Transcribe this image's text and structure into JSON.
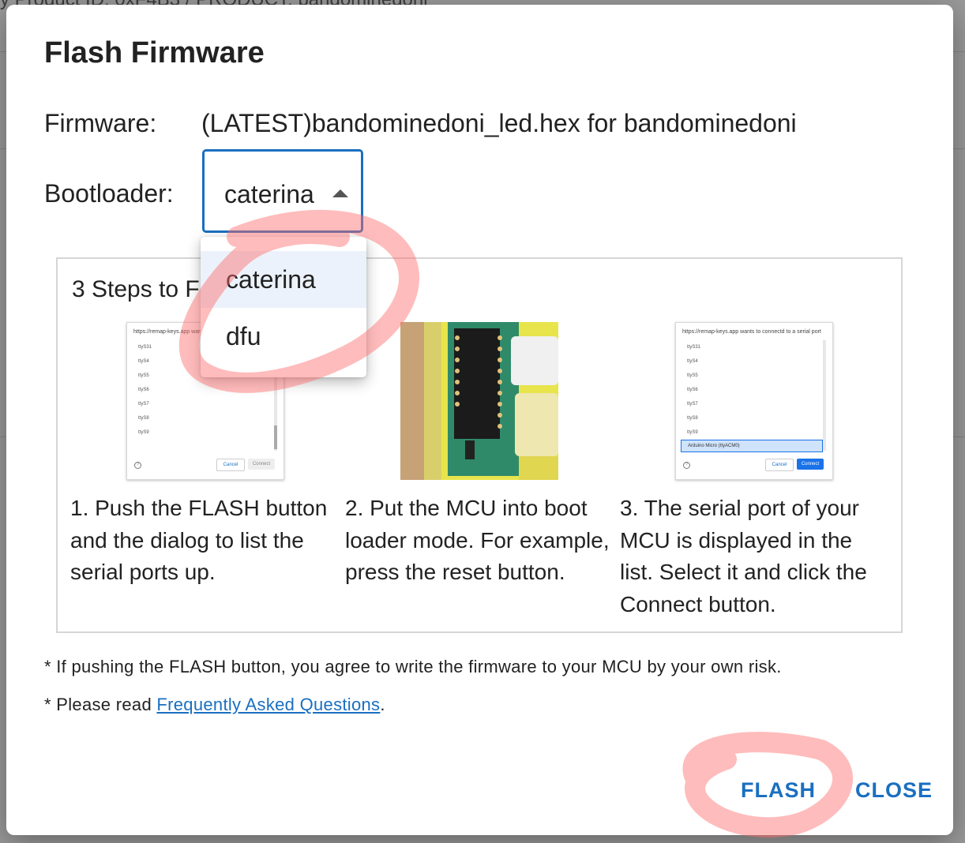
{
  "background": {
    "top_text": "y Product ID: 0xF4B3 / PRODUCT: bandominedoni"
  },
  "dialog": {
    "title": "Flash Firmware",
    "firmware_label": "Firmware:",
    "firmware_value": "(LATEST)bandominedoni_led.hex for bandominedoni",
    "bootloader_label": "Bootloader:",
    "bootloader_selected": "caterina",
    "bootloader_options": [
      "caterina",
      "dfu"
    ],
    "steps_title": "3 Steps to F",
    "steps": [
      {
        "text": "1. Push the FLASH button and the dialog to list the serial ports up."
      },
      {
        "text": "2. Put the MCU into boot loader mode. For example, press the reset button."
      },
      {
        "text": "3. The serial port of your MCU is displayed in the list. Select it and click the Connect button."
      }
    ],
    "serial_dialog": {
      "header_1": "https://remap-keys.app wan",
      "header_3": "https://remap-keys.app wants to connectd to a serial port",
      "ports": [
        "ttyS31",
        "ttyS4",
        "ttyS5",
        "ttyS6",
        "ttyS7",
        "ttyS8",
        "ttyS9"
      ],
      "highlight_port": "Arduino Micro   (ttyACM0)",
      "cancel": "Cancel",
      "connect": "Connect"
    },
    "note_risk": "* If pushing the FLASH button, you agree to write the firmware to your MCU by your own risk.",
    "note_read_prefix": "* Please read ",
    "note_faq_link": "Frequently Asked Questions",
    "note_read_suffix": ".",
    "flash_button": "FLASH",
    "close_button": "CLOSE"
  },
  "colors": {
    "accent": "#1a6fc1",
    "scribble": "#ff6b6b"
  }
}
